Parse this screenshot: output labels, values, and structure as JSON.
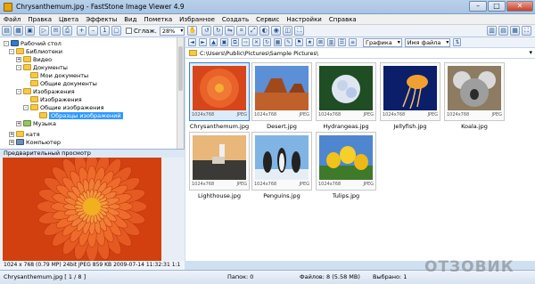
{
  "window": {
    "title": "Chrysanthemum.jpg  -  FastStone Image Viewer 4.9"
  },
  "menu": [
    "Файл",
    "Правка",
    "Цвета",
    "Эффекты",
    "Вид",
    "Пометка",
    "Избранное",
    "Создать",
    "Сервис",
    "Настройки",
    "Справка"
  ],
  "toolbar": {
    "smooth_label": "Сглаж.",
    "zoom_value": "28%",
    "view_mode": "Графика",
    "sort_by": "Имя файла"
  },
  "tree": [
    {
      "label": "Рабочий стол",
      "icon": "desktop-icon",
      "expanded": "-"
    },
    {
      "label": "Библиотеки",
      "icon": "folder-icon",
      "expanded": "-"
    },
    {
      "label": "Видео",
      "icon": "folder-icon",
      "expanded": "+"
    },
    {
      "label": "Документы",
      "icon": "folder-icon",
      "expanded": "-"
    },
    {
      "label": "Мои документы",
      "icon": "folder-icon",
      "expanded": ""
    },
    {
      "label": "Общие документы",
      "icon": "folder-icon",
      "expanded": ""
    },
    {
      "label": "Изображения",
      "icon": "folder-icon",
      "expanded": "-"
    },
    {
      "label": "Изображения",
      "icon": "folder-icon",
      "expanded": ""
    },
    {
      "label": "Общие изображения",
      "icon": "folder-icon",
      "expanded": "-"
    },
    {
      "label": "Образцы изображений",
      "icon": "folder-icon",
      "expanded": "",
      "selected": true
    },
    {
      "label": "Музыка",
      "icon": "music-icon",
      "expanded": "+"
    },
    {
      "label": "катя",
      "icon": "folder-icon",
      "expanded": "+"
    },
    {
      "label": "Компьютер",
      "icon": "computer-icon",
      "expanded": "+"
    }
  ],
  "preview": {
    "header": "Предварительный просмотр",
    "info": "1024 x 768 (0.79 MP)  24bit  JPEG   859 KB   2009-07-14 11:32:31   1:1"
  },
  "path": "C:\\Users\\Public\\Pictures\\Sample Pictures\\",
  "thumbnails": [
    {
      "name": "Chrysanthemum.jpg",
      "dims": "1024x768",
      "type": "JPEG",
      "selected": true
    },
    {
      "name": "Desert.jpg",
      "dims": "1024x768",
      "type": "JPEG"
    },
    {
      "name": "Hydrangeas.jpg",
      "dims": "1024x768",
      "type": "JPEG"
    },
    {
      "name": "Jellyfish.jpg",
      "dims": "1024x768",
      "type": "JPEG"
    },
    {
      "name": "Koala.jpg",
      "dims": "1024x768",
      "type": "JPEG"
    },
    {
      "name": "Lighthouse.jpg",
      "dims": "1024x768",
      "type": "JPEG"
    },
    {
      "name": "Penguins.jpg",
      "dims": "1024x768",
      "type": "JPEG"
    },
    {
      "name": "Tulips.jpg",
      "dims": "1024x768",
      "type": "JPEG"
    }
  ],
  "status": {
    "file_pos": "Chrysanthemum.jpg [ 1 / 8 ]",
    "folders": "Папок: 0",
    "files": "Файлов: 8 (5.58 MB)",
    "selected": "Выбрано: 1"
  },
  "watermark": "ОТЗОВИК",
  "colors": {
    "selection": "#3399ff",
    "frame_selected": "#3c7fd0"
  }
}
